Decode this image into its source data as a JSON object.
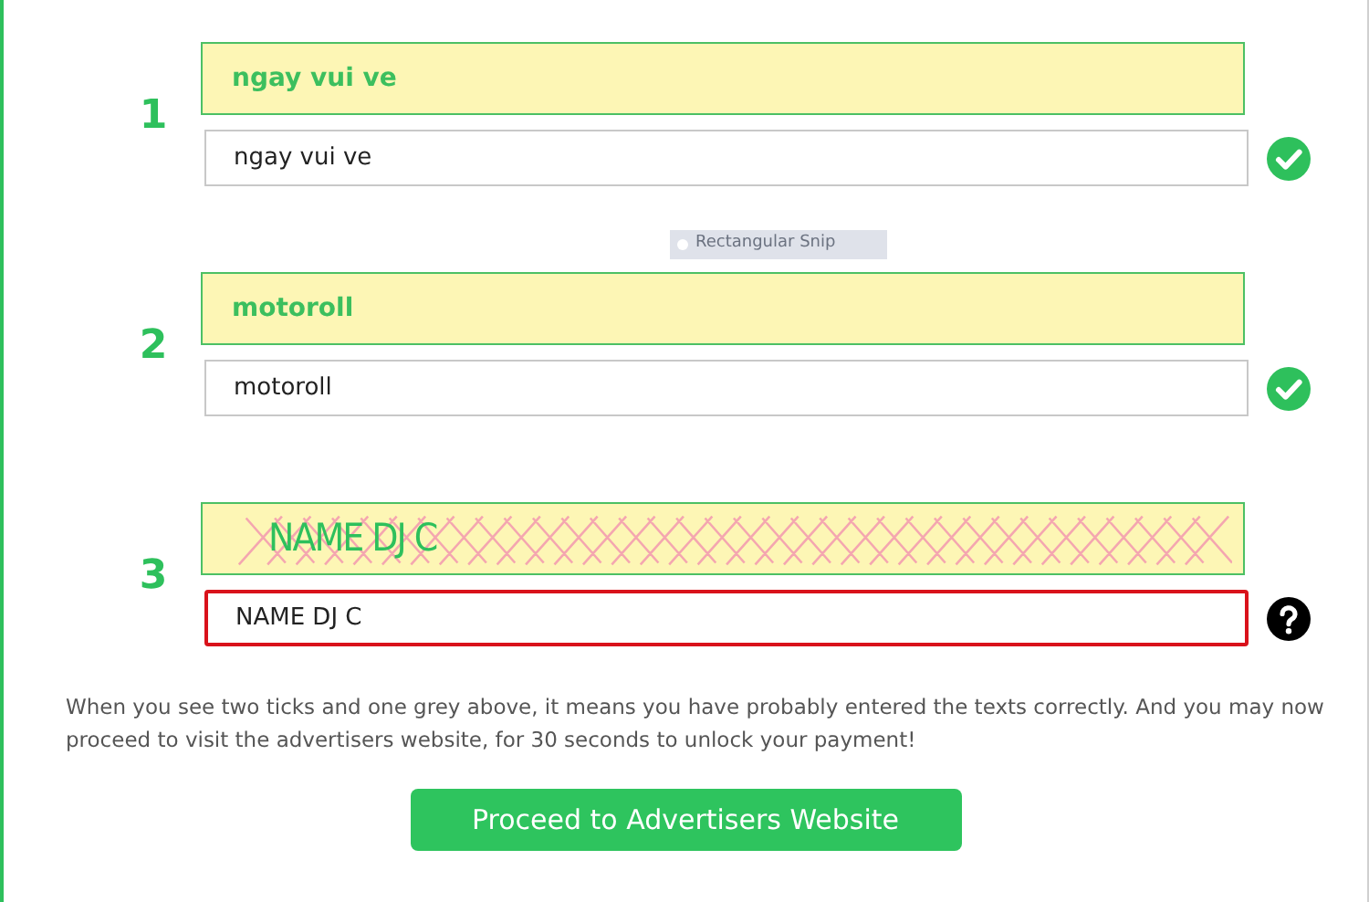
{
  "captchas": [
    {
      "number": "1",
      "challenge": "ngay vui ve",
      "distorted": false,
      "value": "ngay vui ve",
      "valid": true
    },
    {
      "number": "2",
      "challenge": "motoroll",
      "distorted": false,
      "value": "motoroll",
      "valid": true
    },
    {
      "number": "3",
      "challenge": "NAME DJ C",
      "distorted": true,
      "value": "NAME DJ C",
      "valid": false
    }
  ],
  "snip_label": "Rectangular Snip",
  "notice": "When you see two ticks and one grey above, it means you have probably entered the texts correctly. And you may now proceed to visit the advertisers website, for 30 seconds to unlock your payment!",
  "proceed_button": "Proceed to Advertisers Website"
}
